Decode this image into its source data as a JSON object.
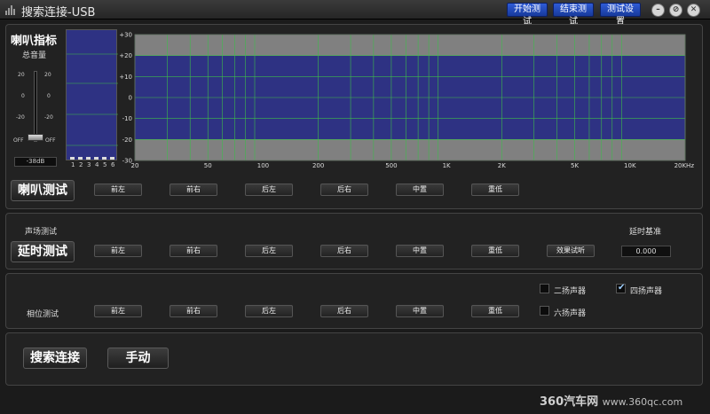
{
  "window": {
    "title": "搜索连接-USB",
    "buttons": [
      "开始测试",
      "结束测试",
      "测试设置"
    ]
  },
  "speaker_index": {
    "title": "喇叭指标",
    "master_volume_label": "总音量",
    "slider_ticks_left": [
      "20",
      "0",
      "-20",
      "OFF"
    ],
    "slider_ticks_right": [
      "20",
      "0",
      "-20",
      "OFF"
    ],
    "db_readout": "-38dB",
    "channel_numbers": [
      "1",
      "2",
      "3",
      "4",
      "5",
      "6"
    ]
  },
  "chart_data": {
    "type": "line",
    "title": "",
    "xlabel": "",
    "ylabel": "",
    "x_scale": "log",
    "xlim": [
      20,
      20000
    ],
    "ylim": [
      -30,
      30
    ],
    "y_ticks": [
      "+30",
      "+20",
      "+10",
      "0",
      "-10",
      "-20",
      "-30"
    ],
    "x_ticks": [
      "20",
      "50",
      "100",
      "200",
      "500",
      "1K",
      "2K",
      "5K",
      "10K",
      "20KHz"
    ],
    "x_tick_values": [
      20,
      50,
      100,
      200,
      500,
      1000,
      2000,
      5000,
      10000,
      20000
    ],
    "band_upper": [
      20,
      30
    ],
    "band_lower": [
      -30,
      -20
    ],
    "colors": {
      "plot_area": "#2e3283",
      "band": "#808080",
      "grid": "#3dbb4a"
    },
    "series": []
  },
  "channels": [
    "前左",
    "前右",
    "后左",
    "后右",
    "中置",
    "重低"
  ],
  "speaker_test": {
    "button": "喇叭测试"
  },
  "delay_test": {
    "section_label": "声场测试",
    "button": "延时测试",
    "effect_button": "效果试听",
    "delay_base_label": "延时基准",
    "delay_value": "0.000"
  },
  "phase_test": {
    "label": "相位测试",
    "options": [
      {
        "label": "二扬声器",
        "checked": false
      },
      {
        "label": "四扬声器",
        "checked": true
      },
      {
        "label": "六扬声器",
        "checked": false
      }
    ]
  },
  "bottom": {
    "search_button": "搜索连接",
    "manual_button": "手动"
  },
  "watermark": {
    "brand": "360汽车网",
    "url": "www.360qc.com"
  }
}
